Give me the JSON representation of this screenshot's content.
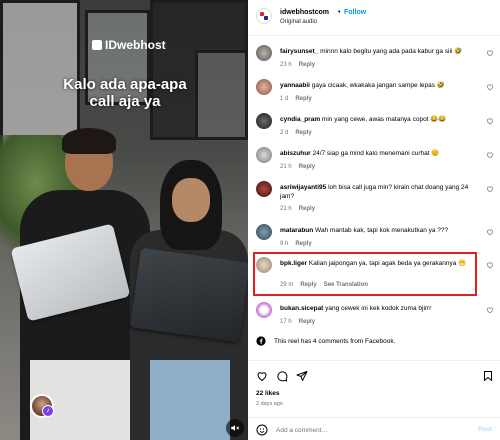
{
  "video": {
    "brand_text": "IDwebhost",
    "caption_line1": "Kalo ada apa-apa",
    "caption_line2": "call aja ya"
  },
  "header": {
    "username": "idwebhostcom",
    "separator": "•",
    "follow_label": "Follow",
    "audio": "Original audio"
  },
  "comments": [
    {
      "user": "fairysunset_",
      "text": "minnn kalo begitu yang ada pada kabur ga siii 🤣",
      "time": "23 h",
      "reply": "Reply"
    },
    {
      "user": "yannaabii",
      "text": "gaya cicaak, wkakaka jangan sampe lepas 🤣",
      "time": "1 d",
      "reply": "Reply"
    },
    {
      "user": "cyndia_pram",
      "text": "min yang cewe, awas matanya copot 😂😂",
      "time": "2 d",
      "reply": "Reply"
    },
    {
      "user": "abiszuhur",
      "text": "24/7 siap ga mind kalo menemani curhat 😊",
      "time": "21 h",
      "reply": "Reply"
    },
    {
      "user": "asriwijayanti95",
      "text": "loh bisa call juga min? kirain chat doang yang 24 jam?",
      "time": "21 h",
      "reply": "Reply"
    },
    {
      "user": "matarabun",
      "text": "Wah mantab kak, tapi kok menakutkan ya ???",
      "time": "9 h",
      "reply": "Reply"
    },
    {
      "user": "bpk.liger",
      "text": "Kalian jaipongan ya, tapi agak beda ya gerakannya 😁",
      "time": "29 m",
      "reply": "Reply",
      "translate": "See Translation"
    },
    {
      "user": "bukan.sicepat",
      "text": "yang cewek ini kek kodok zuma bjirrr",
      "time": "17 h",
      "reply": "Reply"
    }
  ],
  "facebook_note": "This reel has 4 comments from Facebook.",
  "likes": "22 likes",
  "posted": "2 days ago",
  "add_comment": {
    "placeholder": "Add a comment…",
    "post_label": "Post"
  },
  "colors": {
    "follow": "#0095f6",
    "highlight": "#e02020",
    "post_disabled": "#b2dffc"
  }
}
